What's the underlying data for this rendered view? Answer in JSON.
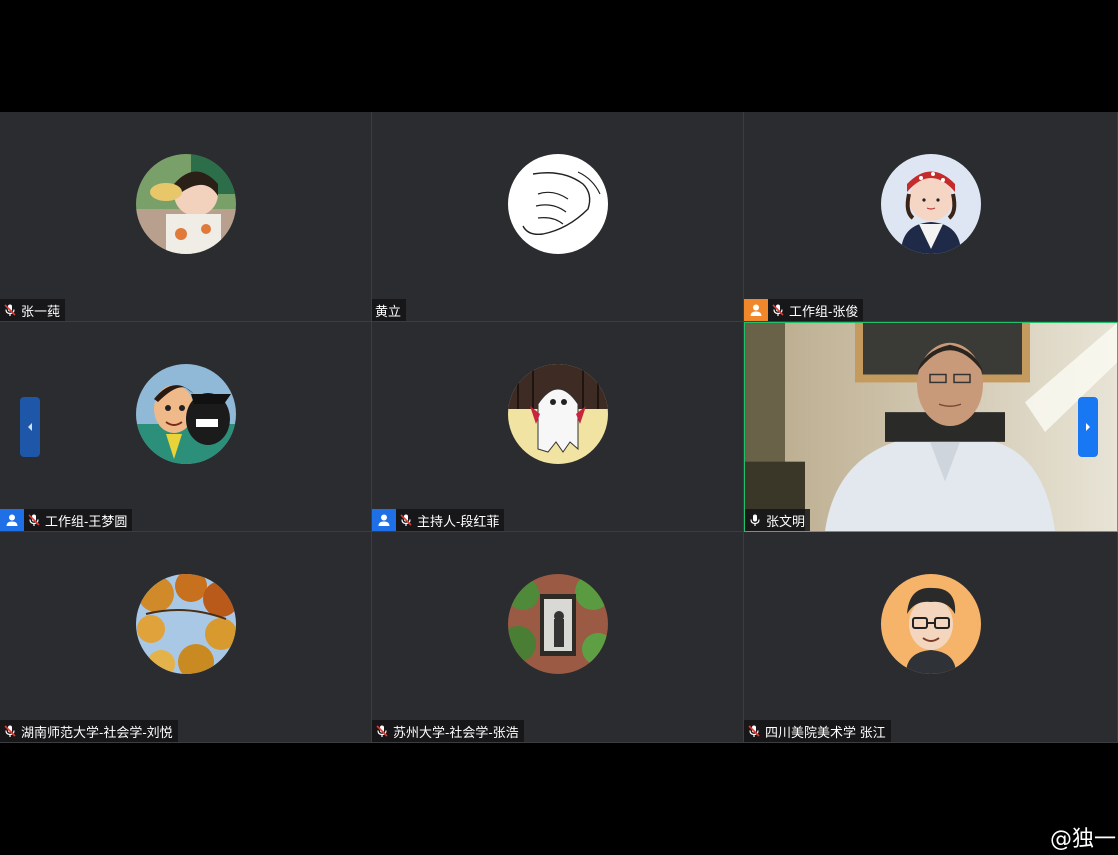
{
  "meeting": {
    "participants": [
      {
        "name": "张一莼",
        "badge": "",
        "avatar": "photo-child-eating"
      },
      {
        "name": "黄立",
        "badge": "",
        "avatar": "hand-sketch"
      },
      {
        "name": "工作组-张俊",
        "badge": "orange",
        "avatar": "cartoon-girl-red-hat"
      },
      {
        "name": "工作组-王梦圆",
        "badge": "blue",
        "avatar": "cartoon-lupin"
      },
      {
        "name": "主持人-段红菲",
        "badge": "blue",
        "avatar": "cartoon-ghost"
      },
      {
        "name": "张文明",
        "badge": "",
        "avatar": "live-video",
        "mic_active": true
      },
      {
        "name": "湖南师范大学-社会学-刘悦",
        "badge": "",
        "avatar": "photo-autumn-leaves"
      },
      {
        "name": "苏州大学-社会学-张浩",
        "badge": "",
        "avatar": "photo-ivy-window"
      },
      {
        "name": "四川美院美术学 张江",
        "badge": "",
        "avatar": "cartoon-man-glasses"
      }
    ]
  },
  "watermark": "@独一",
  "colors": {
    "active_border": "#23c06b",
    "host_badge_blue": "#1f6fe6",
    "host_badge_orange": "#f0872a",
    "tile_bg": "#2b2c2f"
  }
}
